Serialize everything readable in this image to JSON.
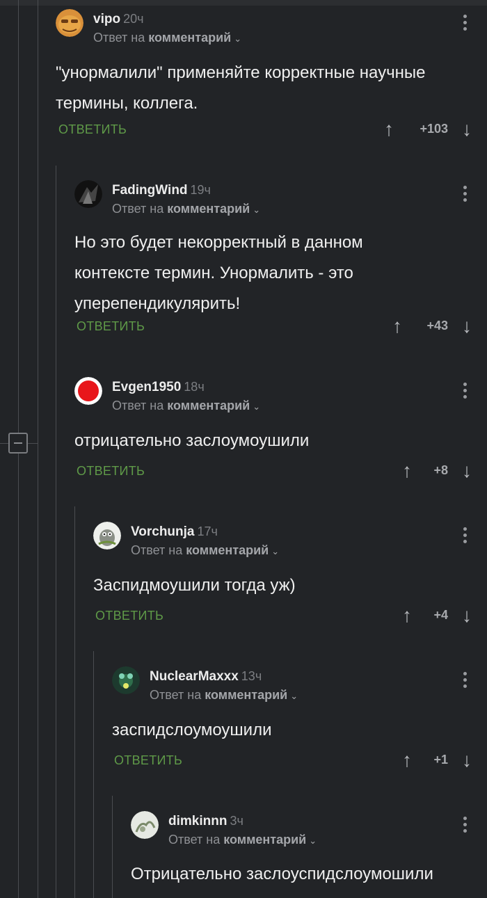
{
  "comments": [
    {
      "author": "vipo",
      "time": "20ч",
      "reply_prefix": "Ответ на",
      "reply_target": "комментарий",
      "text_lines": [
        "\"унормалили\" применяйте корректные научные",
        "термины, коллега."
      ],
      "reply_label": "ОТВЕТИТЬ",
      "rating": "+103"
    },
    {
      "author": "FadingWind",
      "time": "19ч",
      "reply_prefix": "Ответ на",
      "reply_target": "комментарий",
      "text_lines": [
        "Но это будет некорректный в данном",
        "контексте термин. Унормалить - это",
        "уперепендикулярить!"
      ],
      "reply_label": "ОТВЕТИТЬ",
      "rating": "+43"
    },
    {
      "author": "Evgen1950",
      "time": "18ч",
      "reply_prefix": "Ответ на",
      "reply_target": "комментарий",
      "text_lines": [
        "отрицательно заслоумоушили"
      ],
      "reply_label": "ОТВЕТИТЬ",
      "rating": "+8"
    },
    {
      "author": "Vorchunja",
      "time": "17ч",
      "reply_prefix": "Ответ на",
      "reply_target": "комментарий",
      "text_lines": [
        "Заспидмоушили тогда уж)"
      ],
      "reply_label": "ОТВЕТИТЬ",
      "rating": "+4"
    },
    {
      "author": "NuclearMaxxx",
      "time": "13ч",
      "reply_prefix": "Ответ на",
      "reply_target": "комментарий",
      "text_lines": [
        "заспидслоумоушили"
      ],
      "reply_label": "ОТВЕТИТЬ",
      "rating": "+1"
    },
    {
      "author": "dimkinnn",
      "time": "3ч",
      "reply_prefix": "Ответ на",
      "reply_target": "комментарий",
      "text_lines": [
        "Отрицательно заслоуспидслоумошили"
      ]
    }
  ],
  "icons": {
    "upvote": "arrow-up-icon",
    "downvote": "arrow-down-icon",
    "more": "more-vertical-icon",
    "collapse": "minus-square-icon",
    "expand_reply": "chevron-down-icon"
  },
  "colors": {
    "background": "#222427",
    "reply_action": "#5f9a48",
    "thread_line": "#4b4d51",
    "evgen_avatar": "#e8161b"
  }
}
